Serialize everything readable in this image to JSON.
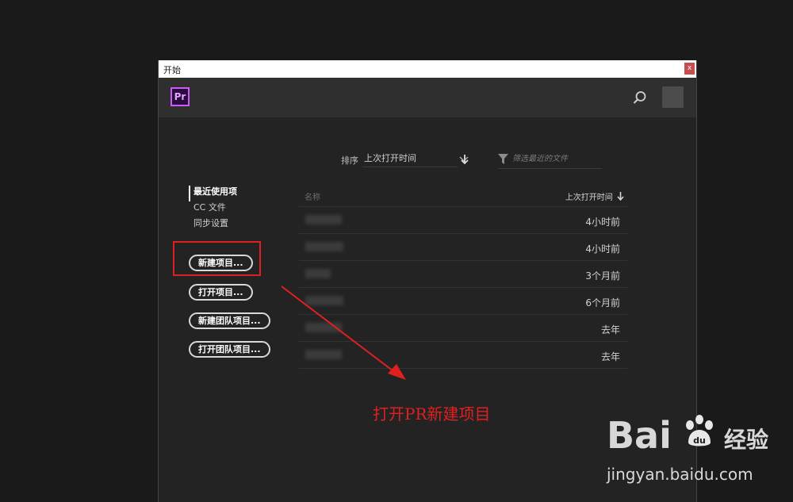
{
  "window": {
    "title": "开始",
    "close_label": "x"
  },
  "app": {
    "logo": "Pr"
  },
  "sort": {
    "label": "排序",
    "value": "上次打开时间"
  },
  "filter": {
    "placeholder": "筛选最近的文件"
  },
  "nav": {
    "items": [
      "最近使用项",
      "CC 文件",
      "同步设置"
    ]
  },
  "buttons": {
    "new_project": "新建项目...",
    "open_project": "打开项目...",
    "new_team_project": "新建团队项目...",
    "open_team_project": "打开团队项目..."
  },
  "table": {
    "col_name": "名称",
    "col_date": "上次打开时间",
    "rows": [
      {
        "date": "4小时前"
      },
      {
        "date": "4小时前"
      },
      {
        "date": "3个月前"
      },
      {
        "date": "6个月前"
      },
      {
        "date": "去年"
      },
      {
        "date": "去年"
      }
    ]
  },
  "annotation": {
    "text": "打开PR新建项目",
    "color": "#e02020"
  },
  "watermark": {
    "brand_left": "Bai",
    "brand_right": "经验",
    "url": "jingyan.baidu.com"
  },
  "colors": {
    "accent": "#c85cf5",
    "background": "#232323"
  }
}
